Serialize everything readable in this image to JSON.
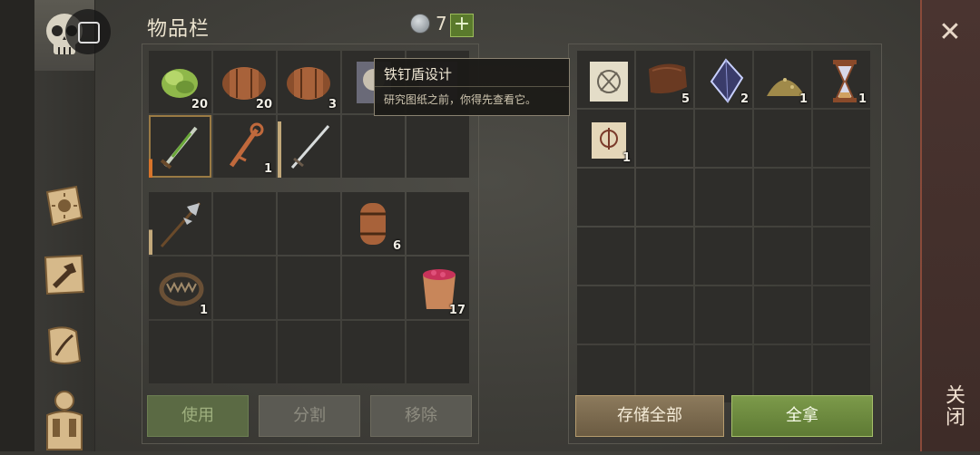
{
  "header": {
    "title": "物品栏",
    "gem_count": "7",
    "add_label": "+"
  },
  "tooltip": {
    "title": "铁钉盾设计",
    "body": "研究图纸之前，你得先查看它。"
  },
  "inventory_top": [
    {
      "icon": "lettuce-icon",
      "count": "20"
    },
    {
      "icon": "barrel-icon",
      "count": "20"
    },
    {
      "icon": "barrel-icon",
      "count": "3"
    },
    {
      "icon": "blueprint-portrait-icon",
      "count": ""
    },
    {
      "icon": "purple-item-icon",
      "count": ""
    },
    {
      "icon": "green-sword-icon",
      "count": "",
      "durability": 0.3,
      "selected": true
    },
    {
      "icon": "copper-key-icon",
      "count": "1"
    },
    {
      "icon": "steel-sword-icon",
      "count": "",
      "durability": 0.9
    },
    {
      "icon": "empty",
      "count": ""
    },
    {
      "icon": "empty",
      "count": ""
    }
  ],
  "inventory_bag": [
    {
      "icon": "halberd-icon",
      "count": "",
      "durability": 0.4
    },
    {
      "icon": "empty",
      "count": ""
    },
    {
      "icon": "empty",
      "count": ""
    },
    {
      "icon": "small-barrel-icon",
      "count": "6"
    },
    {
      "icon": "empty",
      "count": ""
    },
    {
      "icon": "bear-trap-icon",
      "count": "1"
    },
    {
      "icon": "empty",
      "count": ""
    },
    {
      "icon": "empty",
      "count": ""
    },
    {
      "icon": "empty",
      "count": ""
    },
    {
      "icon": "berry-bucket-icon",
      "count": "17"
    },
    {
      "icon": "empty",
      "count": ""
    },
    {
      "icon": "empty",
      "count": ""
    },
    {
      "icon": "empty",
      "count": ""
    },
    {
      "icon": "empty",
      "count": ""
    },
    {
      "icon": "empty",
      "count": ""
    }
  ],
  "external": [
    {
      "icon": "map-icon",
      "count": ""
    },
    {
      "icon": "leather-icon",
      "count": "5"
    },
    {
      "icon": "crystal-icon",
      "count": "2"
    },
    {
      "icon": "powder-pile-icon",
      "count": "1"
    },
    {
      "icon": "hourglass-icon",
      "count": "1"
    },
    {
      "icon": "scroll-icon",
      "count": "1"
    }
  ],
  "buttons": {
    "use": "使用",
    "split": "分割",
    "remove": "移除",
    "store_all": "存储全部",
    "take_all": "全拿"
  },
  "close": {
    "label": "关闭",
    "x": "✕"
  }
}
